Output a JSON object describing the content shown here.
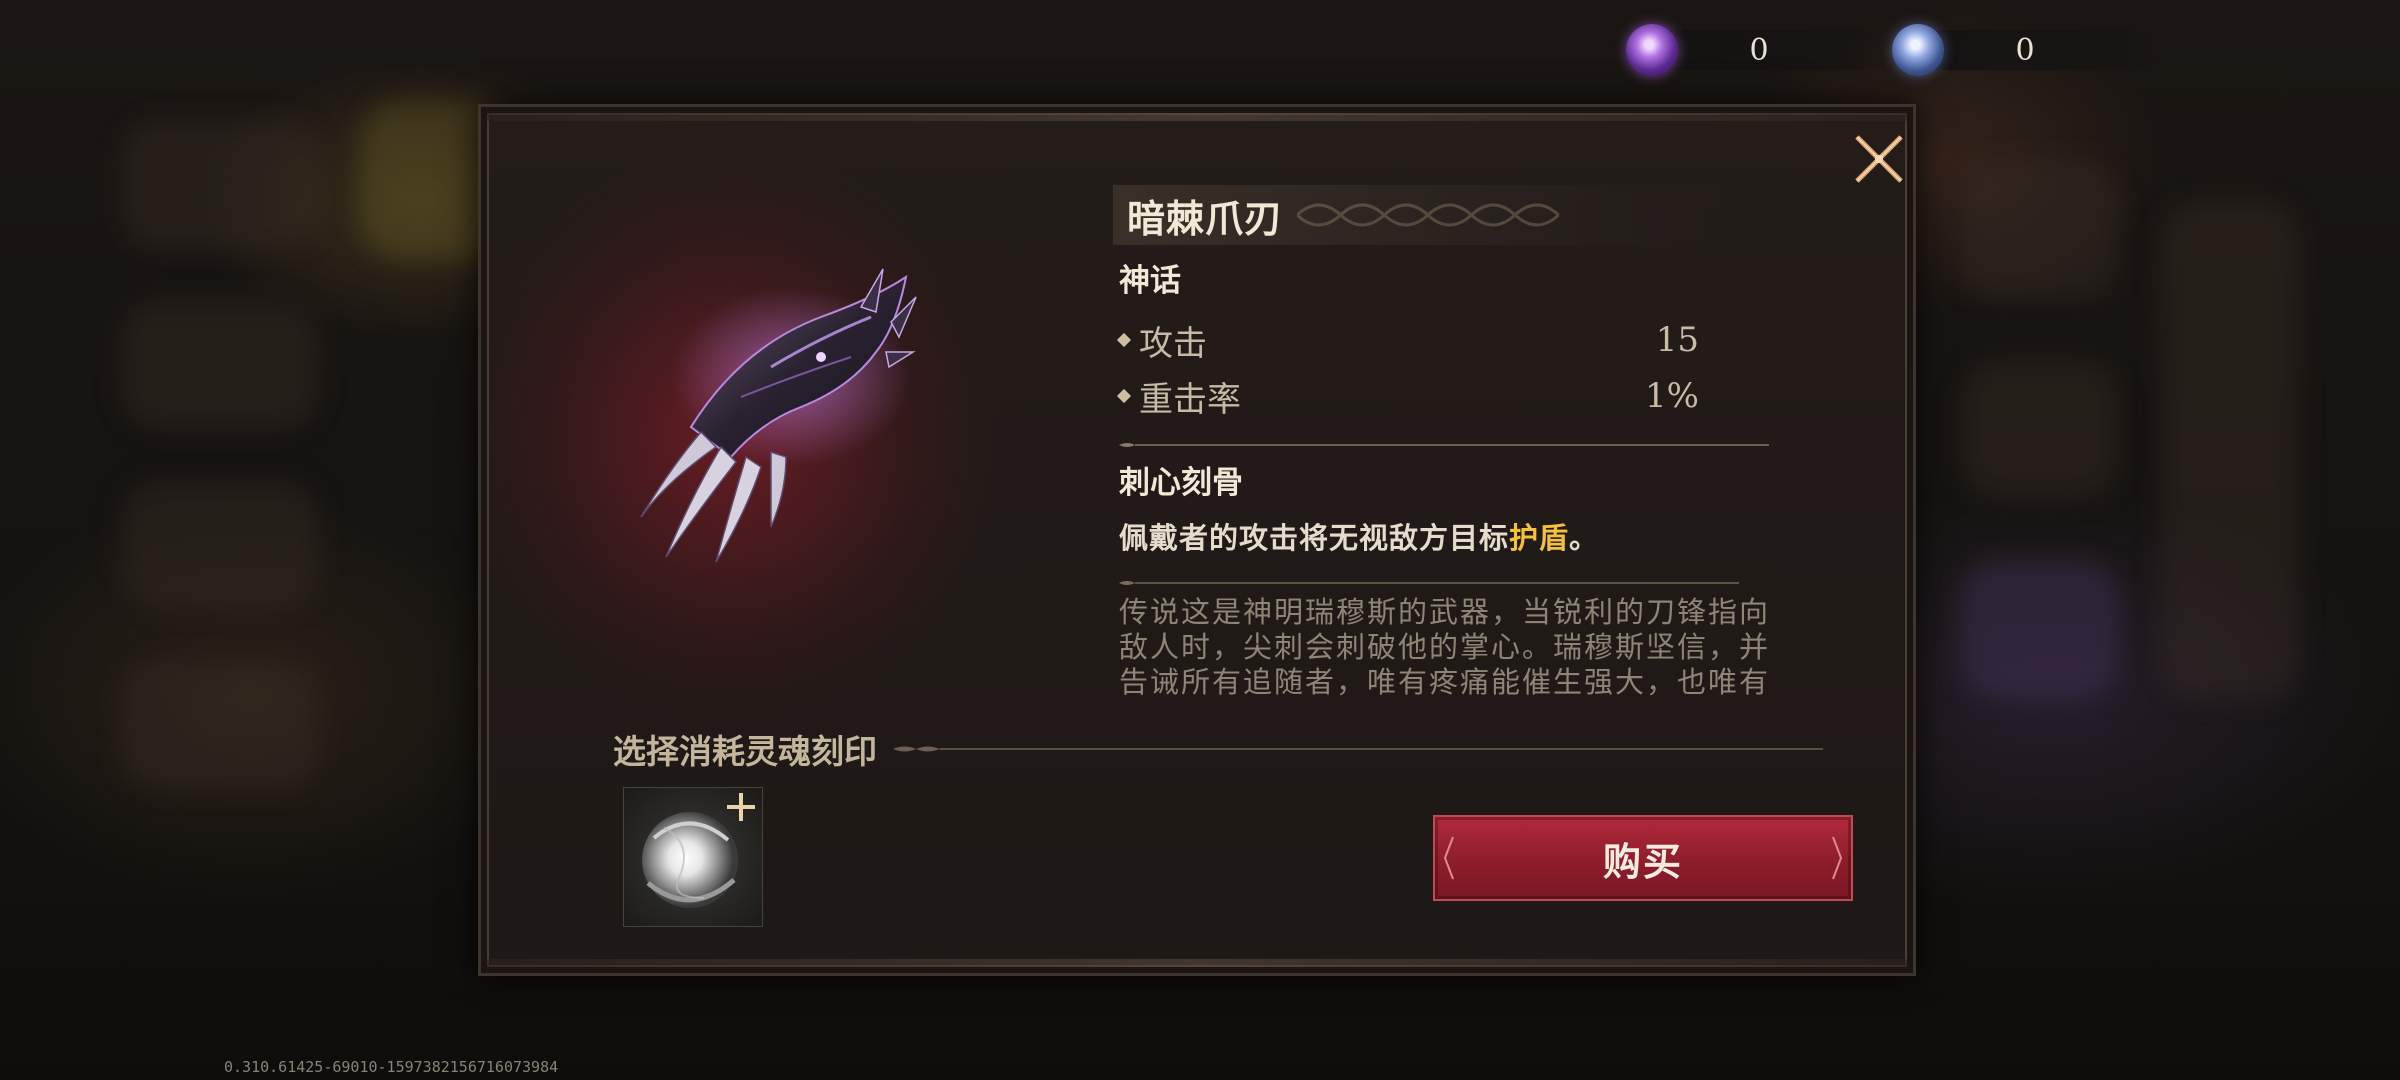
{
  "currencies": [
    {
      "icon": "purple-soul-orb-icon",
      "amount": "0"
    },
    {
      "icon": "blue-soul-orb-icon",
      "amount": "0"
    }
  ],
  "item": {
    "name": "暗棘爪刃",
    "rarity": "神话",
    "art_icon": "dark-claw-blade-icon",
    "stats": [
      {
        "label": "攻击",
        "value": "15"
      },
      {
        "label": "重击率",
        "value": "1%"
      }
    ],
    "skill": {
      "name": "刺心刻骨",
      "desc_prefix": "佩戴者的攻击将无视敌方目标",
      "desc_highlight": "护盾",
      "desc_suffix": "。"
    },
    "lore": "传说这是神明瑞穆斯的武器，当锐利的刀锋指向敌人时，尖刺会刺破他的掌心。瑞穆斯坚信，并告诫所有追随者，唯有疼痛能催生强大，也唯有"
  },
  "soul_select": {
    "title": "选择消耗灵魂刻印",
    "slot_icon": "soul-seal-orb-icon",
    "add_icon": "plus-icon"
  },
  "actions": {
    "buy_label": "购买",
    "close_icon": "close-x-icon"
  },
  "version": "0.310.61425-69010-1597382156716073984",
  "colors": {
    "highlight": "#f4c23a",
    "buy_button": "#9b2231",
    "panel_bg": "#211a17"
  }
}
